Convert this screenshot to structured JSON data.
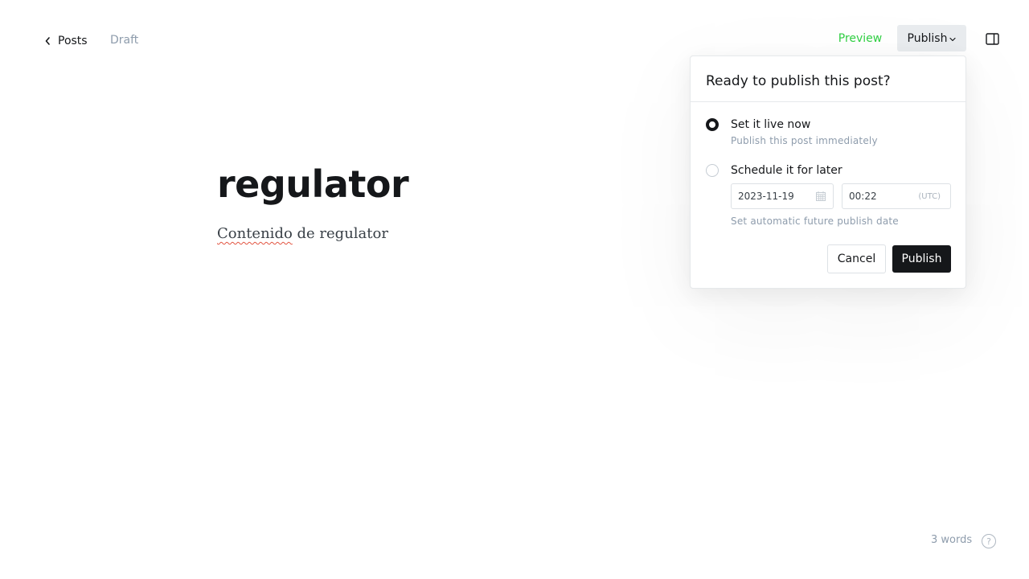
{
  "nav": {
    "back_label": "Posts",
    "status": "Draft",
    "preview_label": "Preview",
    "publish_label": "Publish"
  },
  "editor": {
    "title": "regulator",
    "body_misspelled": "Contenido",
    "body_rest": " de regulator"
  },
  "publish_menu": {
    "heading": "Ready to publish this post?",
    "option_now": {
      "label": "Set it live now",
      "description": "Publish this post immediately",
      "selected": true
    },
    "option_schedule": {
      "label": "Schedule it for later",
      "date": "2023-11-19",
      "time": "00:22",
      "timezone": "(UTC)",
      "hint": "Set automatic future publish date",
      "selected": false
    },
    "cancel_label": "Cancel",
    "confirm_label": "Publish"
  },
  "footer": {
    "word_count": "3 words",
    "help_label": "?"
  },
  "colors": {
    "accent_green": "#30cf43",
    "dark": "#15171a",
    "muted": "#8e9cac"
  },
  "icons": {
    "back": "chevron-left-icon",
    "publish_caret": "chevron-down-icon",
    "sidebar": "sidebar-toggle-icon",
    "calendar": "calendar-icon",
    "help": "help-circle-icon"
  }
}
